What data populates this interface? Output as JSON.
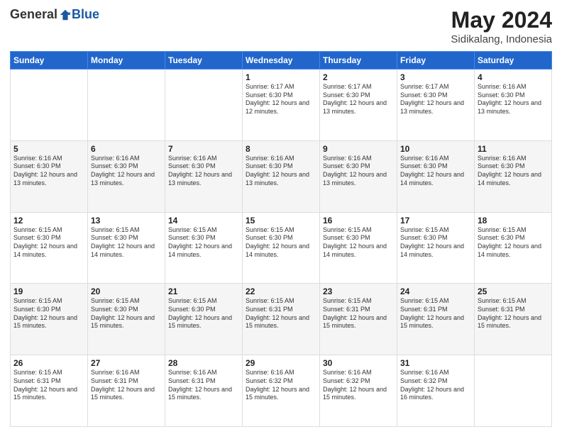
{
  "header": {
    "logo_general": "General",
    "logo_blue": "Blue",
    "month_title": "May 2024",
    "location": "Sidikalang, Indonesia"
  },
  "days_of_week": [
    "Sunday",
    "Monday",
    "Tuesday",
    "Wednesday",
    "Thursday",
    "Friday",
    "Saturday"
  ],
  "weeks": [
    [
      {
        "day": "",
        "info": ""
      },
      {
        "day": "",
        "info": ""
      },
      {
        "day": "",
        "info": ""
      },
      {
        "day": "1",
        "info": "Sunrise: 6:17 AM\nSunset: 6:30 PM\nDaylight: 12 hours\nand 12 minutes."
      },
      {
        "day": "2",
        "info": "Sunrise: 6:17 AM\nSunset: 6:30 PM\nDaylight: 12 hours\nand 13 minutes."
      },
      {
        "day": "3",
        "info": "Sunrise: 6:17 AM\nSunset: 6:30 PM\nDaylight: 12 hours\nand 13 minutes."
      },
      {
        "day": "4",
        "info": "Sunrise: 6:16 AM\nSunset: 6:30 PM\nDaylight: 12 hours\nand 13 minutes."
      }
    ],
    [
      {
        "day": "5",
        "info": "Sunrise: 6:16 AM\nSunset: 6:30 PM\nDaylight: 12 hours\nand 13 minutes."
      },
      {
        "day": "6",
        "info": "Sunrise: 6:16 AM\nSunset: 6:30 PM\nDaylight: 12 hours\nand 13 minutes."
      },
      {
        "day": "7",
        "info": "Sunrise: 6:16 AM\nSunset: 6:30 PM\nDaylight: 12 hours\nand 13 minutes."
      },
      {
        "day": "8",
        "info": "Sunrise: 6:16 AM\nSunset: 6:30 PM\nDaylight: 12 hours\nand 13 minutes."
      },
      {
        "day": "9",
        "info": "Sunrise: 6:16 AM\nSunset: 6:30 PM\nDaylight: 12 hours\nand 13 minutes."
      },
      {
        "day": "10",
        "info": "Sunrise: 6:16 AM\nSunset: 6:30 PM\nDaylight: 12 hours\nand 14 minutes."
      },
      {
        "day": "11",
        "info": "Sunrise: 6:16 AM\nSunset: 6:30 PM\nDaylight: 12 hours\nand 14 minutes."
      }
    ],
    [
      {
        "day": "12",
        "info": "Sunrise: 6:15 AM\nSunset: 6:30 PM\nDaylight: 12 hours\nand 14 minutes."
      },
      {
        "day": "13",
        "info": "Sunrise: 6:15 AM\nSunset: 6:30 PM\nDaylight: 12 hours\nand 14 minutes."
      },
      {
        "day": "14",
        "info": "Sunrise: 6:15 AM\nSunset: 6:30 PM\nDaylight: 12 hours\nand 14 minutes."
      },
      {
        "day": "15",
        "info": "Sunrise: 6:15 AM\nSunset: 6:30 PM\nDaylight: 12 hours\nand 14 minutes."
      },
      {
        "day": "16",
        "info": "Sunrise: 6:15 AM\nSunset: 6:30 PM\nDaylight: 12 hours\nand 14 minutes."
      },
      {
        "day": "17",
        "info": "Sunrise: 6:15 AM\nSunset: 6:30 PM\nDaylight: 12 hours\nand 14 minutes."
      },
      {
        "day": "18",
        "info": "Sunrise: 6:15 AM\nSunset: 6:30 PM\nDaylight: 12 hours\nand 14 minutes."
      }
    ],
    [
      {
        "day": "19",
        "info": "Sunrise: 6:15 AM\nSunset: 6:30 PM\nDaylight: 12 hours\nand 15 minutes."
      },
      {
        "day": "20",
        "info": "Sunrise: 6:15 AM\nSunset: 6:30 PM\nDaylight: 12 hours\nand 15 minutes."
      },
      {
        "day": "21",
        "info": "Sunrise: 6:15 AM\nSunset: 6:30 PM\nDaylight: 12 hours\nand 15 minutes."
      },
      {
        "day": "22",
        "info": "Sunrise: 6:15 AM\nSunset: 6:31 PM\nDaylight: 12 hours\nand 15 minutes."
      },
      {
        "day": "23",
        "info": "Sunrise: 6:15 AM\nSunset: 6:31 PM\nDaylight: 12 hours\nand 15 minutes."
      },
      {
        "day": "24",
        "info": "Sunrise: 6:15 AM\nSunset: 6:31 PM\nDaylight: 12 hours\nand 15 minutes."
      },
      {
        "day": "25",
        "info": "Sunrise: 6:15 AM\nSunset: 6:31 PM\nDaylight: 12 hours\nand 15 minutes."
      }
    ],
    [
      {
        "day": "26",
        "info": "Sunrise: 6:15 AM\nSunset: 6:31 PM\nDaylight: 12 hours\nand 15 minutes."
      },
      {
        "day": "27",
        "info": "Sunrise: 6:16 AM\nSunset: 6:31 PM\nDaylight: 12 hours\nand 15 minutes."
      },
      {
        "day": "28",
        "info": "Sunrise: 6:16 AM\nSunset: 6:31 PM\nDaylight: 12 hours\nand 15 minutes."
      },
      {
        "day": "29",
        "info": "Sunrise: 6:16 AM\nSunset: 6:32 PM\nDaylight: 12 hours\nand 15 minutes."
      },
      {
        "day": "30",
        "info": "Sunrise: 6:16 AM\nSunset: 6:32 PM\nDaylight: 12 hours\nand 15 minutes."
      },
      {
        "day": "31",
        "info": "Sunrise: 6:16 AM\nSunset: 6:32 PM\nDaylight: 12 hours\nand 16 minutes."
      },
      {
        "day": "",
        "info": ""
      }
    ]
  ]
}
